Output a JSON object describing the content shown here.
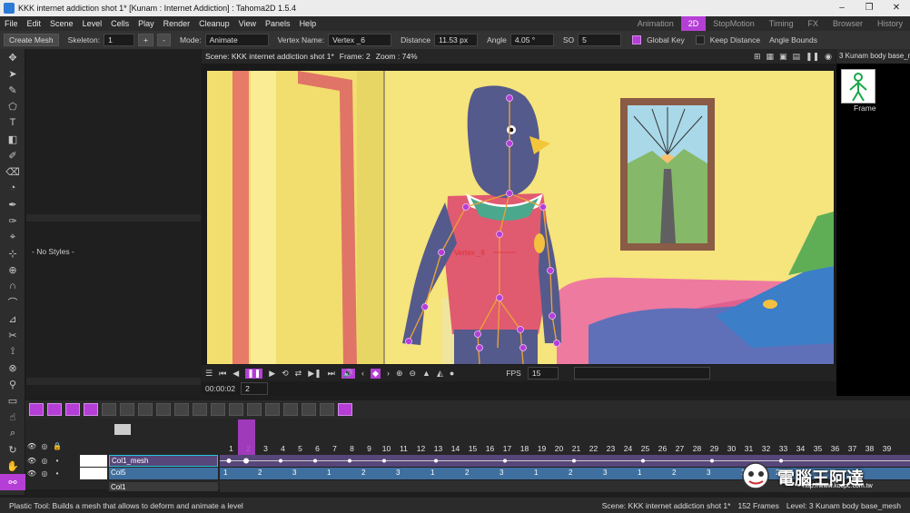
{
  "window": {
    "title": "KKK internet addiction shot 1* [Kunam : Internet Addiction] : Tahoma2D 1.5.4"
  },
  "menu": [
    "File",
    "Edit",
    "Scene",
    "Level",
    "Cells",
    "Play",
    "Render",
    "Cleanup",
    "View",
    "Panels",
    "Help"
  ],
  "rooms": [
    {
      "label": "Animation",
      "active": false
    },
    {
      "label": "2D",
      "active": true
    },
    {
      "label": "StopMotion",
      "active": false
    },
    {
      "label": "Timing",
      "active": false
    },
    {
      "label": "FX",
      "active": false
    },
    {
      "label": "Browser",
      "active": false
    },
    {
      "label": "History",
      "active": false
    }
  ],
  "tooloptions": {
    "create_mesh": "Create Mesh",
    "skeleton_label": "Skeleton:",
    "skeleton_value": "1",
    "plus": "+",
    "minus": "-",
    "mode_label": "Mode:",
    "mode_value": "Animate",
    "vertex_label": "Vertex Name:",
    "vertex_value": "Vertex _6",
    "distance_label": "Distance",
    "distance_value": "11.53 px",
    "angle_label": "Angle",
    "angle_value": "4.05 °",
    "so_label": "SO",
    "so_value": "5",
    "global_key": "Global Key",
    "keep_distance": "Keep Distance",
    "angle_bounds": "Angle Bounds"
  },
  "styles": {
    "label": "- No Styles -"
  },
  "viewer": {
    "scene_label": "Scene: KKK internet addiction shot 1*",
    "frame_label": "Frame: 2",
    "zoom_label": "Zoom : 74%",
    "vertex_annotation": "Vertex _6",
    "fps_label": "FPS",
    "fps_value": "15",
    "timecode": "00:00:02",
    "frame_field": "2"
  },
  "levelstrip": {
    "title": "3 Kunam body base_mesh",
    "frame_label": "Frame"
  },
  "timeline": {
    "frames": [
      "1",
      "2",
      "3",
      "4",
      "5",
      "6",
      "7",
      "8",
      "9",
      "10",
      "11",
      "12",
      "13",
      "14",
      "15",
      "16",
      "17",
      "18",
      "19",
      "20",
      "21",
      "22",
      "23",
      "24",
      "25",
      "26",
      "27",
      "28",
      "29",
      "30",
      "31",
      "32",
      "33",
      "34",
      "35",
      "36",
      "37",
      "38",
      "39"
    ],
    "current_frame": 2,
    "layers": [
      {
        "name": "Col1_mesh"
      },
      {
        "name": "Col5"
      },
      {
        "name": "Col1"
      }
    ],
    "row2_cells": [
      "1",
      "2",
      "3",
      "1",
      "2",
      "3",
      "1",
      "2",
      "3",
      "1",
      "2",
      "3",
      "1",
      "2",
      "3",
      "1",
      "2"
    ]
  },
  "status": {
    "left": "Plastic Tool: Builds a mesh that allows to deform and animate a level",
    "scene": "Scene: KKK internet addiction shot 1*",
    "frames": "152 Frames",
    "level": "Level: 3 Kunam body base_mesh"
  },
  "watermark": {
    "text": "電腦王阿達",
    "url": "http://www.kocpc.com.tw"
  },
  "colors": {
    "accent": "#b53fd6",
    "layer_mesh": "#57467a",
    "layer_col": "#3f6f9e"
  }
}
